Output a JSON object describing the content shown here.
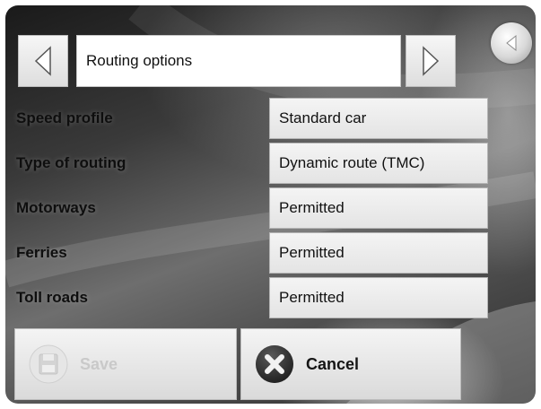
{
  "header": {
    "title": "Routing options"
  },
  "options": [
    {
      "label": "Speed profile",
      "value": "Standard car"
    },
    {
      "label": "Type of routing",
      "value": "Dynamic route (TMC)"
    },
    {
      "label": "Motorways",
      "value": "Permitted"
    },
    {
      "label": "Ferries",
      "value": "Permitted"
    },
    {
      "label": "Toll roads",
      "value": "Permitted"
    }
  ],
  "buttons": {
    "save_label": "Save",
    "cancel_label": "Cancel"
  },
  "icons": {
    "back": "back-arrow-icon",
    "prev": "triangle-left-icon",
    "next": "triangle-right-icon",
    "save": "floppy-disk-icon",
    "cancel": "cross-icon"
  },
  "states": {
    "save_enabled": false
  }
}
